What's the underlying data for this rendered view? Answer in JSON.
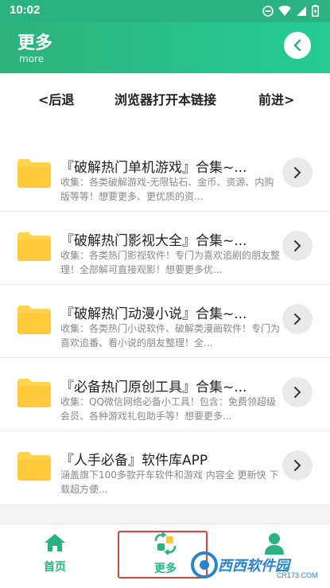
{
  "status": {
    "time": "10:02"
  },
  "header": {
    "title": "更多",
    "subtitle": "more"
  },
  "nav": {
    "back": "<后退",
    "open_browser": "浏览器打开本链接",
    "forward": "前进>"
  },
  "items": [
    {
      "title": "『破解热门单机游戏』合集~...",
      "desc": "收集：各类破解游戏-无限钻石、金币、资源、内购版等等！想要更多、更优质的资..."
    },
    {
      "title": "『破解热门影视大全』合集~...",
      "desc": "收集：各类热门影视软件！专门为喜欢追剧的朋友整理！全部解可直接观影！想要更多优..."
    },
    {
      "title": "『破解热门动漫小说』合集~...",
      "desc": "收集：各类热门小说软件、破解类漫画软件！专门为喜欢追番、看小说的朋友整理！全..."
    },
    {
      "title": "『必备热门原创工具』合集~...",
      "desc": "收集：QQ微信网络必备小工具！包含：免费领超级会员、各种游戏礼包助手等！想要更多..."
    },
    {
      "title": "『人手必备』软件库APP",
      "desc": "涵盖旗下100多款开车软件和游戏 内容全 更新快 下载超方便..."
    }
  ],
  "tabs": [
    {
      "label": "首页",
      "icon": "home-icon"
    },
    {
      "label": "更多",
      "icon": "refresh-icon"
    },
    {
      "label": "",
      "icon": "user-icon"
    }
  ],
  "watermark": {
    "text": "西西软件园",
    "sub": "CR173.COM"
  },
  "colors": {
    "accent": "#2ab380",
    "highlight": "#d9443a",
    "folder": "#ffd34f"
  }
}
